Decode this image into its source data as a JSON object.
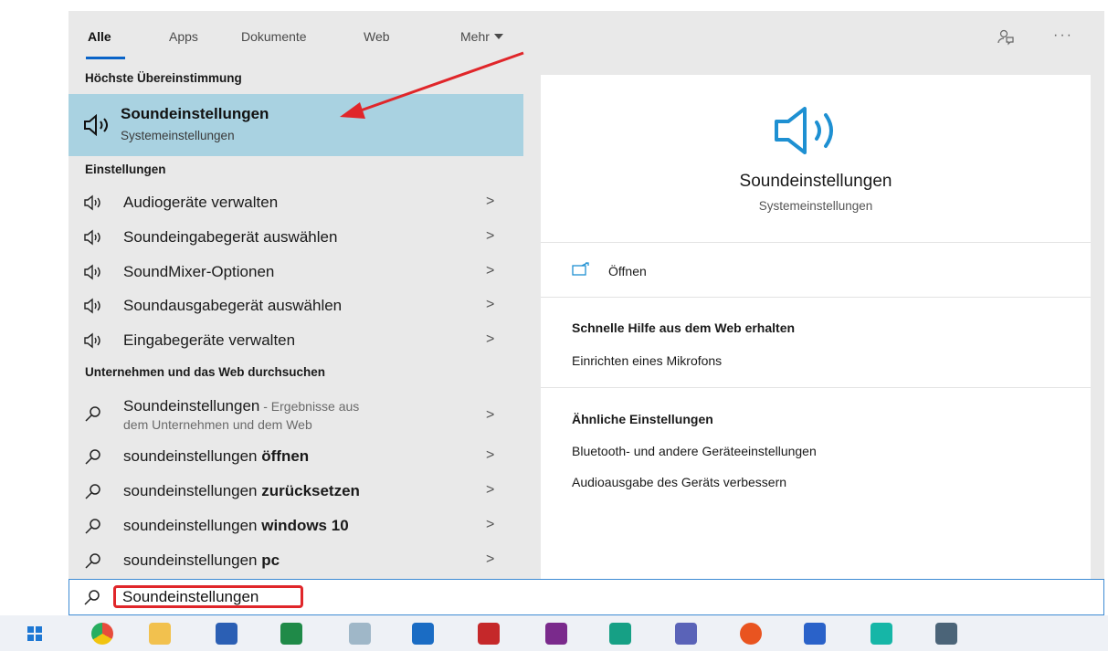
{
  "tabs": [
    {
      "label": "Alle"
    },
    {
      "label": "Apps"
    },
    {
      "label": "Dokumente"
    },
    {
      "label": "Web"
    },
    {
      "label": "Mehr"
    }
  ],
  "best_match": {
    "heading": "Höchste Übereinstimmung",
    "title": "Soundeinstellungen",
    "subtitle": "Systemeinstellungen"
  },
  "settings": {
    "heading": "Einstellungen",
    "items": [
      {
        "label": "Audiogeräte verwalten"
      },
      {
        "label": "Soundeingabegerät auswählen"
      },
      {
        "label": "SoundMixer-Optionen"
      },
      {
        "label": "Soundausgabegerät auswählen"
      },
      {
        "label": "Eingabegeräte verwalten"
      }
    ]
  },
  "web": {
    "heading": "Unternehmen und das Web durchsuchen",
    "first": {
      "title": "Soundeinstellungen",
      "sub_line1": " - Ergebnisse aus",
      "sub_line2": "dem Unternehmen und dem Web"
    },
    "items": [
      {
        "prefix": "soundeinstellungen ",
        "bold": "öffnen"
      },
      {
        "prefix": "soundeinstellungen ",
        "bold": "zurücksetzen"
      },
      {
        "prefix": "soundeinstellungen ",
        "bold": "windows 10"
      },
      {
        "prefix": "soundeinstellungen ",
        "bold": "pc"
      }
    ]
  },
  "preview": {
    "title": "Soundeinstellungen",
    "subtitle": "Systemeinstellungen",
    "open_label": "Öffnen",
    "help_heading": "Schnelle Hilfe aus dem Web erhalten",
    "help_link": "Einrichten eines Mikrofons",
    "related_heading": "Ähnliche Einstellungen",
    "related": [
      {
        "label": "Bluetooth- und andere Geräteeinstellungen"
      },
      {
        "label": "Audioausgabe des Geräts verbessern"
      }
    ]
  },
  "search": {
    "value": "Soundeinstellungen"
  },
  "chevron": ">",
  "colors": {
    "accent": "#0a64c8",
    "highlight": "#a9d2e1",
    "annotation": "#e0262a"
  },
  "taskbar_icons": [
    "start-icon",
    "chrome-icon",
    "file-explorer-icon",
    "word-icon",
    "excel-icon",
    "notepad-icon",
    "outlook-icon",
    "filezilla-icon",
    "intellij-icon",
    "app-green-icon",
    "teams-icon",
    "ubuntu-icon",
    "chart-app-icon",
    "webstorm-icon",
    "calculator-icon"
  ]
}
